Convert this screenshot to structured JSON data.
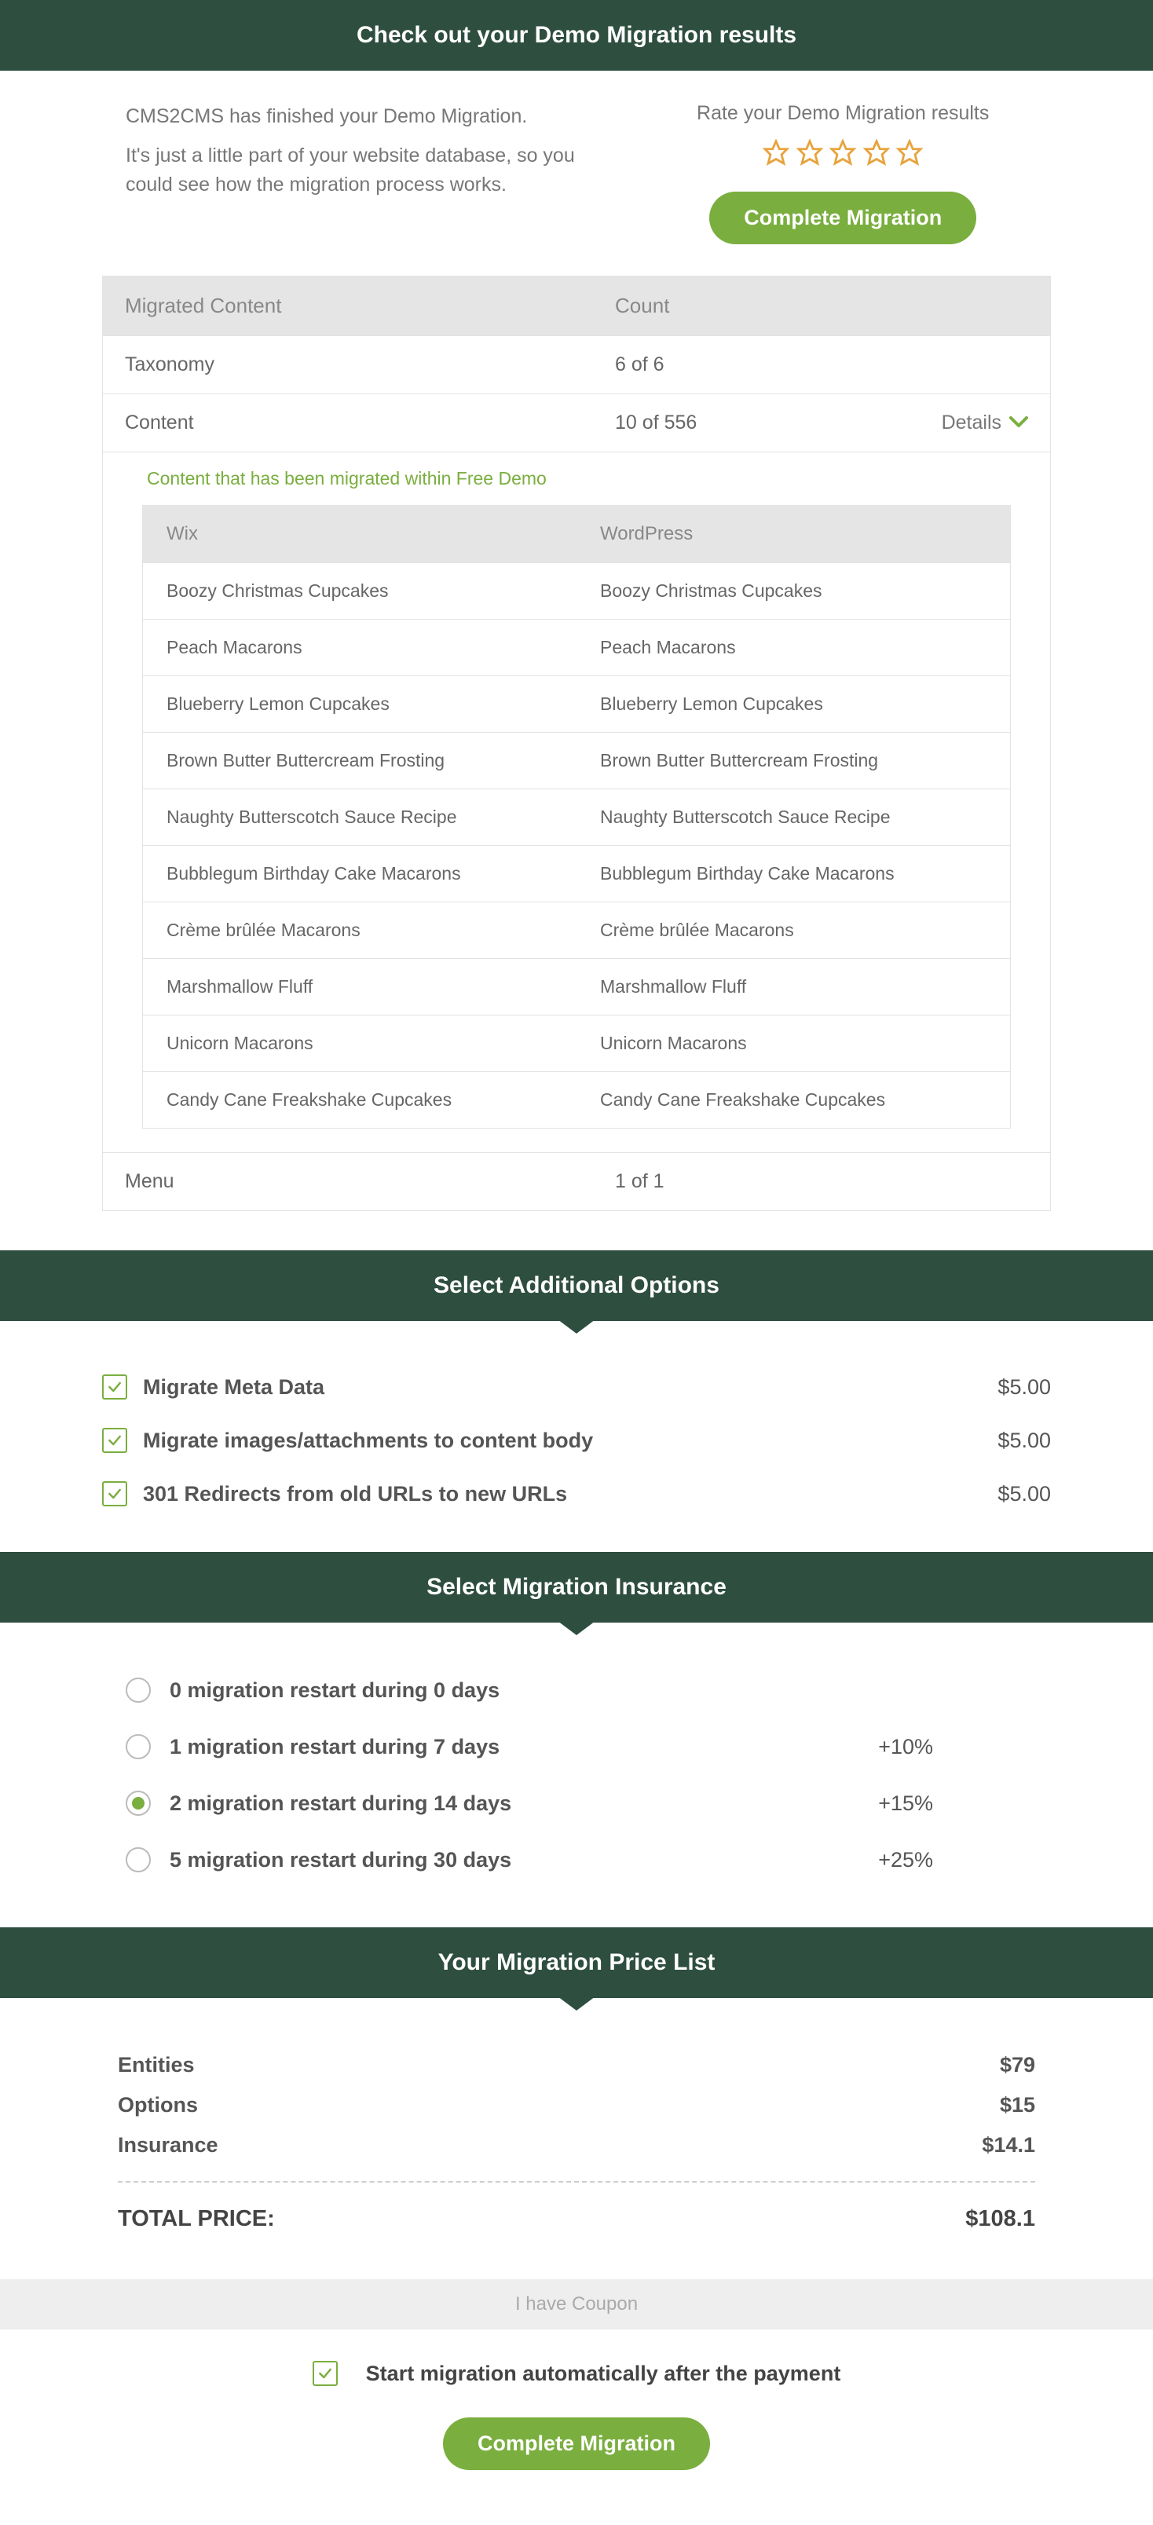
{
  "header1": "Check out your Demo Migration results",
  "demoText1": "CMS2CMS has finished your Demo Migration.",
  "demoText2": "It's just a little part of your website database, so you could see how the migration process works.",
  "rateTitle": "Rate your Demo Migration results",
  "completeMigration": "Complete Migration",
  "migratedHeader1": "Migrated Content",
  "migratedHeader2": "Count",
  "migratedRows": [
    {
      "label": "Taxonomy",
      "count": "6 of 6"
    },
    {
      "label": "Content",
      "count": "10 of 556"
    }
  ],
  "detailsLabel": "Details",
  "subTitle": "Content that has been migrated within Free Demo",
  "innerHead1": "Wix",
  "innerHead2": "WordPress",
  "innerRows": [
    {
      "wix": "Boozy Christmas Cupcakes",
      "wp": "Boozy Christmas Cupcakes"
    },
    {
      "wix": "Peach Macarons",
      "wp": "Peach Macarons"
    },
    {
      "wix": "Blueberry Lemon Cupcakes",
      "wp": "Blueberry Lemon Cupcakes"
    },
    {
      "wix": "Brown Butter Buttercream Frosting",
      "wp": "Brown Butter Buttercream Frosting"
    },
    {
      "wix": "Naughty Butterscotch Sauce Recipe",
      "wp": "Naughty Butterscotch Sauce Recipe"
    },
    {
      "wix": "Bubblegum Birthday Cake Macarons",
      "wp": "Bubblegum Birthday Cake Macarons"
    },
    {
      "wix": "Crème brûlée Macarons",
      "wp": "Crème brûlée Macarons"
    },
    {
      "wix": "Marshmallow Fluff",
      "wp": "Marshmallow Fluff"
    },
    {
      "wix": "Unicorn Macarons",
      "wp": "Unicorn Macarons"
    },
    {
      "wix": "Candy Cane Freakshake Cupcakes",
      "wp": "Candy Cane Freakshake Cupcakes"
    }
  ],
  "menuRow": {
    "label": "Menu",
    "count": "1 of 1"
  },
  "header2": "Select Additional Options",
  "options": [
    {
      "label": "Migrate Meta Data",
      "price": "$5.00"
    },
    {
      "label": "Migrate images/attachments to content body",
      "price": "$5.00"
    },
    {
      "label": "301 Redirects from old URLs to new URLs",
      "price": "$5.00"
    }
  ],
  "header3": "Select Migration Insurance",
  "insurance": [
    {
      "label": "0 migration restart during 0 days",
      "price": ""
    },
    {
      "label": "1 migration restart during 7 days",
      "price": "+10%"
    },
    {
      "label": "2 migration restart during 14 days",
      "price": "+15%"
    },
    {
      "label": "5 migration restart during 30 days",
      "price": "+25%"
    }
  ],
  "header4": "Your Migration Price List",
  "priceRows": [
    {
      "label": "Entities",
      "value": "$79"
    },
    {
      "label": "Options",
      "value": "$15"
    },
    {
      "label": "Insurance",
      "value": "$14.1"
    }
  ],
  "totalLabel": "TOTAL PRICE:",
  "totalValue": "$108.1",
  "couponLabel": "I have Coupon",
  "autoStartLabel": "Start migration automatically after the payment"
}
